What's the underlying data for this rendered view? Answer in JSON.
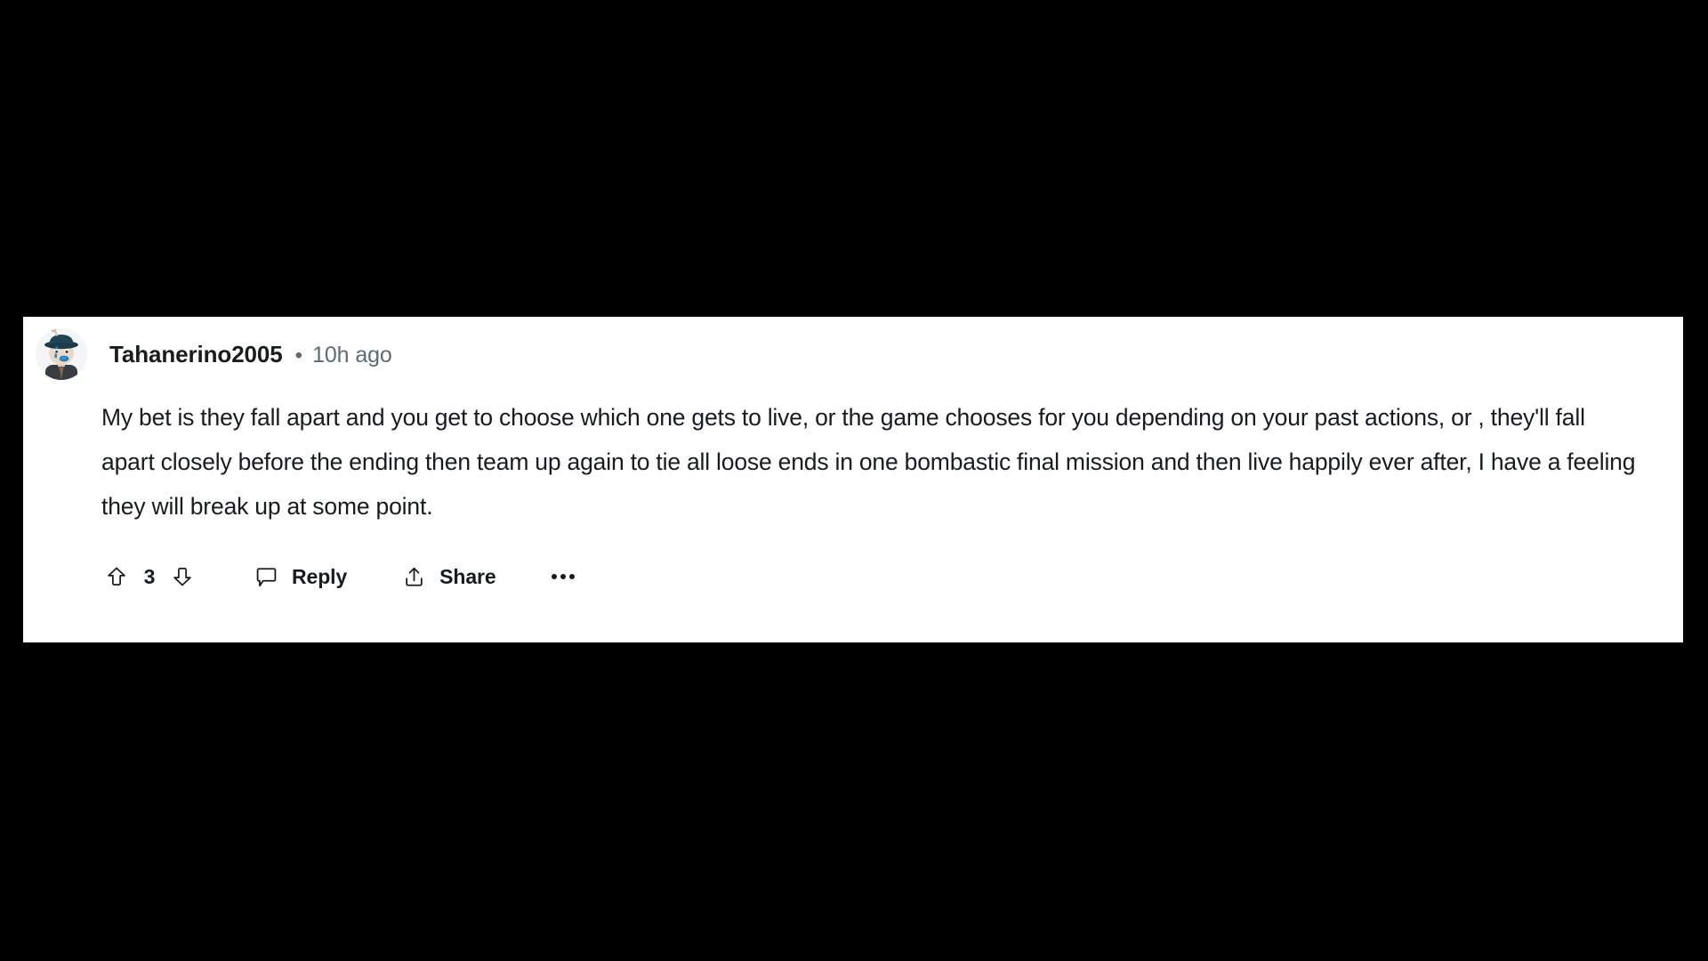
{
  "page": {
    "background_color": "#000000",
    "card_background": "#ffffff"
  },
  "comment": {
    "avatar": {
      "icon": "reddit-snoo-avatar",
      "hat_color": "#1c3b4a",
      "face_color": "#e8d6c3",
      "paint_color": "#1d7fc4",
      "body_color": "#3a3f45",
      "scarf_color": "#7a5a3c"
    },
    "author": "Tahanerino2005",
    "separator": "•",
    "timestamp": "10h ago",
    "text": "My bet is they fall apart and you get to choose which one gets to live, or the game chooses for you depending on your past actions, or , they'll fall apart closely before the ending then team up again to tie all loose ends in one bombastic final mission and then live happily ever after, I have a feeling they will break up at some point.",
    "actions": {
      "upvote_icon": "arrow-up-icon",
      "vote_count": "3",
      "downvote_icon": "arrow-down-icon",
      "reply_icon": "comment-bubble-icon",
      "reply_label": "Reply",
      "share_icon": "share-upload-icon",
      "share_label": "Share",
      "more_icon": "ellipsis-icon"
    },
    "colors": {
      "text": "#181c1f",
      "meta": "#5c6c74"
    }
  }
}
